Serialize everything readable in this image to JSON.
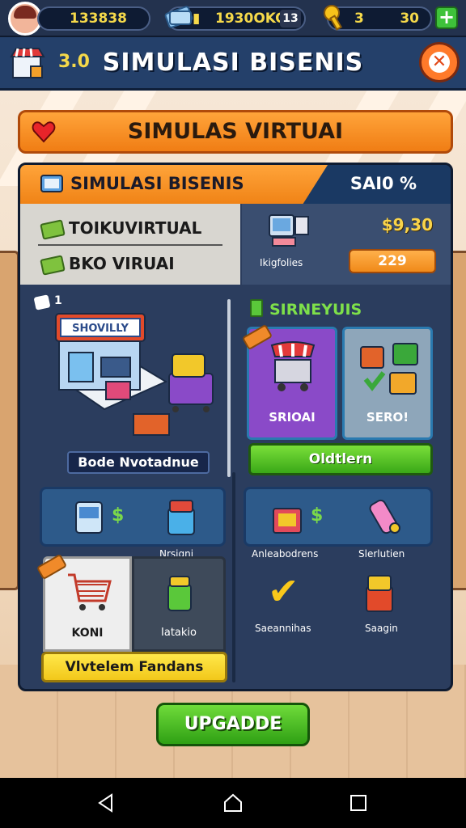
{
  "topbar": {
    "coins": "133838",
    "cash": "1930OKO",
    "cash_badge": "13",
    "keys_label": "3",
    "keys_count": "30",
    "plus_label": "+"
  },
  "titlebar": {
    "level": "3.0",
    "title": "SIMULASI BISENIS",
    "close_label": "✕"
  },
  "banner": {
    "text": "SIMULAS VIRTUAI"
  },
  "panel": {
    "title": "SIMULASI BISENIS",
    "score": "SAI0 %",
    "stats": {
      "line1": "TOIKUVIRTUAL",
      "line2": "BKO VIRUAI",
      "cash_value": "$9,30",
      "caption": "Ikigfolies",
      "chip_value": "229"
    },
    "left": {
      "badge": "1",
      "store_sign": "SHOVILLY",
      "store_label": "Bode Nvotadnue",
      "slot_caption": "Nrsigni",
      "card1_label": "KONI",
      "card2_label": "Iatakio",
      "yellow_button": "Vlvtelem Fandans",
      "dollar": "$"
    },
    "right": {
      "heading": "SIRNEYUIS",
      "card1_label": "SRIOAI",
      "card2_label": "SERO!",
      "green_button": "Oldtlern",
      "caption1": "Anleabodrens",
      "caption2": "Slerlutien",
      "caption3": "Saeannihas",
      "caption4": "Saagin",
      "dollar": "$"
    }
  },
  "upgrade_button": "UPGADDE",
  "colors": {
    "accent_orange": "#f08316",
    "panel_blue": "#2b3d5e",
    "action_green": "#3aa818",
    "gold": "#f5d94a"
  }
}
